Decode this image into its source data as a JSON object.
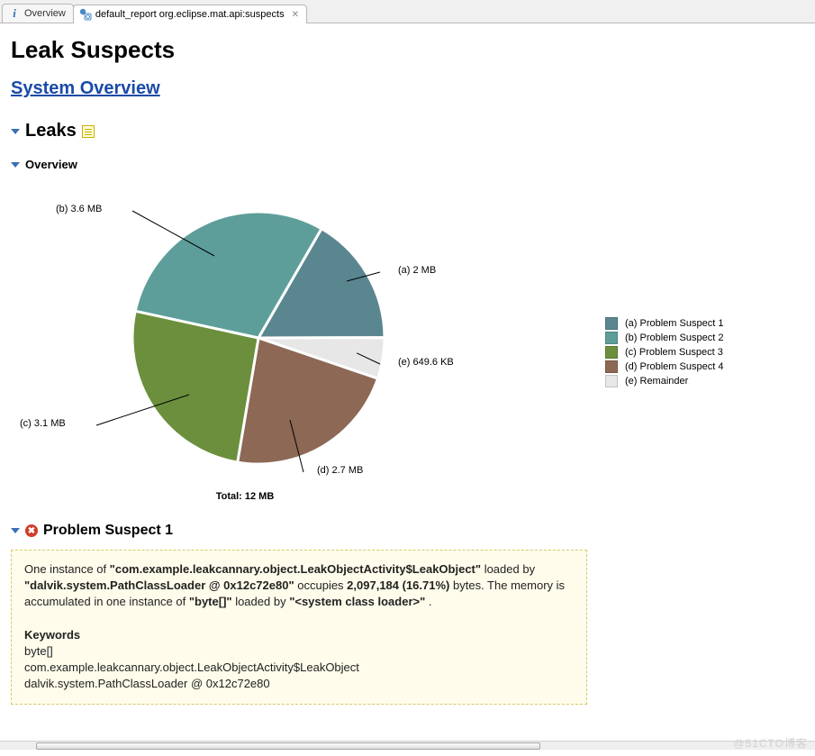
{
  "tabs": {
    "overview": "Overview",
    "report": "default_report  org.eclipse.mat.api:suspects"
  },
  "title": "Leak Suspects",
  "system_overview": "System Overview",
  "sections": {
    "leaks": "Leaks",
    "overview": "Overview",
    "problem1": "Problem Suspect 1"
  },
  "chart_data": {
    "type": "pie",
    "title": "",
    "total_label": "Total: 12 MB",
    "series": [
      {
        "key": "a",
        "name": "Problem Suspect 1",
        "label": "(a)  2 MB",
        "value_mb": 2.0,
        "color": "#5a8690"
      },
      {
        "key": "b",
        "name": "Problem Suspect 2",
        "label": "(b)  3.6 MB",
        "value_mb": 3.6,
        "color": "#5e9e9a"
      },
      {
        "key": "c",
        "name": "Problem Suspect 3",
        "label": "(c)  3.1 MB",
        "value_mb": 3.1,
        "color": "#6b8f3d"
      },
      {
        "key": "d",
        "name": "Problem Suspect 4",
        "label": "(d)  2.7 MB",
        "value_mb": 2.7,
        "color": "#8c6855"
      },
      {
        "key": "e",
        "name": "Remainder",
        "label": "(e)  649.6 KB",
        "value_mb": 0.6344,
        "color": "#e7e7e7"
      }
    ],
    "legend": [
      "(a)  Problem Suspect 1",
      "(b)  Problem Suspect 2",
      "(c)  Problem Suspect 3",
      "(d)  Problem Suspect 4",
      "(e)  Remainder"
    ]
  },
  "problem1": {
    "p_prefix": "One instance of ",
    "class": "\"com.example.leakcannary.object.LeakObjectActivity$LeakObject\"",
    "loaded_by_text": " loaded by ",
    "loader": "\"dalvik.system.PathClassLoader @ 0x12c72e80\"",
    "occupies_text": " occupies ",
    "occupies_val": "2,097,184 (16.71%)",
    "bytes_text": " bytes. The memory is accumulated in one instance of ",
    "bytearr": "\"byte[]\"",
    "loaded_by2": " loaded by ",
    "syscl": "\"<system class loader>\"",
    "period": ".",
    "keywords_h": "Keywords",
    "kw1": "byte[]",
    "kw2": "com.example.leakcannary.object.LeakObjectActivity$LeakObject",
    "kw3": "dalvik.system.PathClassLoader @ 0x12c72e80"
  },
  "watermark": "@51CTO博客"
}
